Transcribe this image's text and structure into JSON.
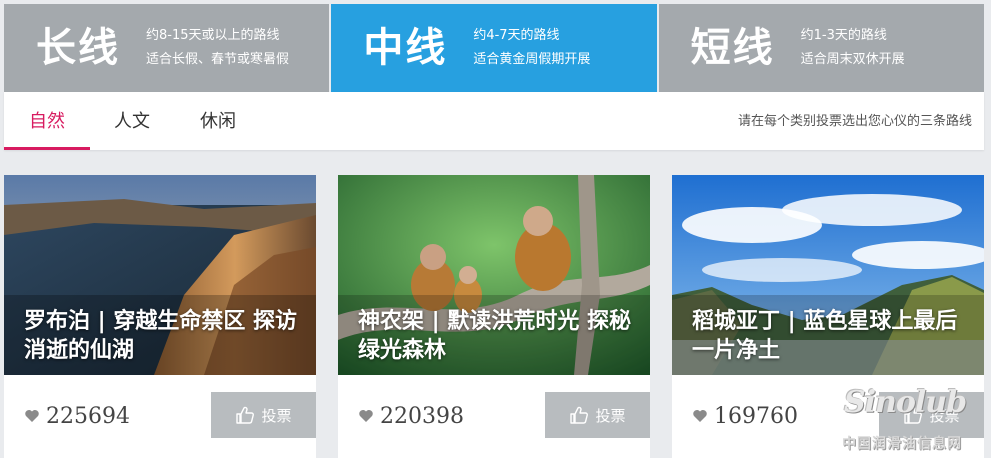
{
  "route_tabs": [
    {
      "label": "长线",
      "desc1": "约8-15天或以上的路线",
      "desc2": "适合长假、春节或寒暑假",
      "active": false
    },
    {
      "label": "中线",
      "desc1": "约4-7天的路线",
      "desc2": "适合黄金周假期开展",
      "active": true
    },
    {
      "label": "短线",
      "desc1": "约1-3天的路线",
      "desc2": "适合周末双休开展",
      "active": false
    }
  ],
  "categories": [
    {
      "label": "自然",
      "active": true
    },
    {
      "label": "人文",
      "active": false
    },
    {
      "label": "休闲",
      "active": false
    }
  ],
  "hint": "请在每个类别投票选出您心仪的三条路线",
  "cards": [
    {
      "title": "罗布泊 | 穿越生命禁区 探访消逝的仙湖",
      "votes": "225694",
      "vote_label": "投票",
      "scene": "desert-lake"
    },
    {
      "title": "神农架 | 默读洪荒时光 探秘绿光森林",
      "votes": "220398",
      "vote_label": "投票",
      "scene": "golden-monkeys"
    },
    {
      "title": "稻城亚丁 | 蓝色星球上最后一片净土",
      "votes": "169760",
      "vote_label": "投票",
      "scene": "blue-sky-mountains"
    }
  ],
  "watermark": {
    "logo": "Sinolub",
    "text": "中国润滑油信息网"
  },
  "colors": {
    "active_tab": "#27a0e0",
    "inactive_tab": "#a4a9ad",
    "category_accent": "#d81b60",
    "vote_button": "#b8bcbf"
  }
}
